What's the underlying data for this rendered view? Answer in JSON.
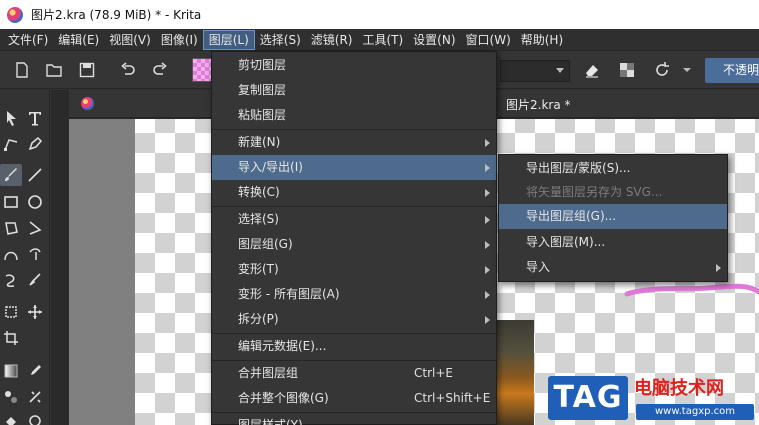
{
  "window": {
    "title": "图片2.kra (78.9 MiB)  * - Krita"
  },
  "menubar": {
    "items": [
      "文件(F)",
      "编辑(E)",
      "视图(V)",
      "图像(I)",
      "图层(L)",
      "选择(S)",
      "滤镜(R)",
      "工具(T)",
      "设置(N)",
      "窗口(W)",
      "帮助(H)"
    ],
    "active": "图层(L)"
  },
  "toolbar": {
    "opacity_label": "不透明"
  },
  "document": {
    "tab_title": "图片2.kra *"
  },
  "layer_menu": {
    "cut": "剪切图层",
    "copy": "复制图层",
    "paste": "粘贴图层",
    "new": "新建(N)",
    "import_export": "导入/导出(I)",
    "convert": "转换(C)",
    "select": "选择(S)",
    "group": "图层组(G)",
    "transform": "变形(T)",
    "transform_all": "变形 - 所有图层(A)",
    "split": "拆分(P)",
    "edit_metadata": "编辑元数据(E)...",
    "merge_group": "合并图层组",
    "merge_group_shortcut": "Ctrl+E",
    "flatten_image": "合并整个图像(G)",
    "flatten_image_shortcut": "Ctrl+Shift+E",
    "layer_style": "图层样式(Y)..."
  },
  "import_export_menu": {
    "export_layer": "导出图层/蒙版(S)...",
    "save_vector_svg": "将矢量图层另存为 SVG...",
    "export_group": "导出图层组(G)...",
    "import_layer": "导入图层(M)...",
    "import": "导入"
  },
  "watermark": {
    "tag": "TAG",
    "site_name": "电脑技术网",
    "url": "www.tagxp.com"
  },
  "colors": {
    "highlight": "#4e6a8c",
    "menubar_active": "#415d80",
    "accent_blue": "#4a6d99",
    "watermark_red": "#e0201c",
    "watermark_blue": "#1f5fb8"
  }
}
